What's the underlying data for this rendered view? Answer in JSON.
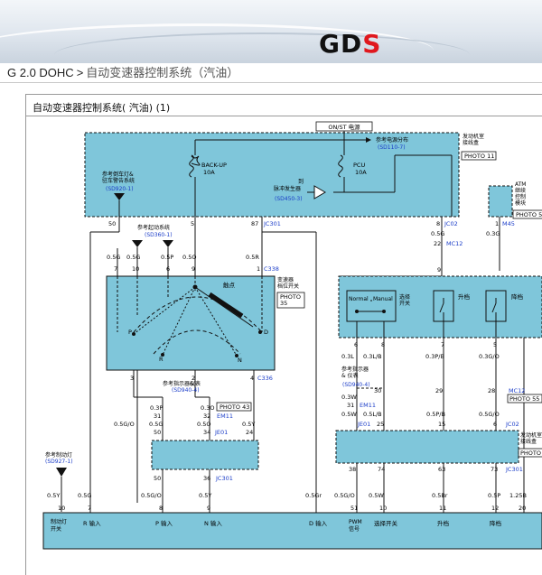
{
  "header": {
    "logo_text": "GD",
    "logo_mark": "S",
    "brand_color": "#e0181e"
  },
  "breadcrumb": {
    "root": "G 2.0 DOHC",
    "separator": ">",
    "current": "自动变速器控制系统（汽油）"
  },
  "panel": {
    "title": "自动变速器控制系统( 汽油) (1)"
  },
  "diagram": {
    "fill_color": "#7fc6da",
    "line_color": "#111111",
    "ref_color": "#1a3cc8",
    "top": {
      "power_label": "ON/ST 电源",
      "junction_box": "发动机室\n接线盒",
      "photo_junction": "PHOTO 11",
      "ref_power": "参考电源分布",
      "ref_power_code": "(SD110-7)",
      "fuse1_name": "BACK-UP",
      "fuse1_rating": "10A",
      "fuse2_name": "PCU",
      "fuse2_rating": "10A",
      "ref_brake": "参考倒车灯&\n驻车警告系统",
      "ref_brake_code": "(SD920-1)",
      "ref_pulse": "到\n脉冲发生器",
      "ref_pulse_code": "(SD450-3)",
      "atm_label": "ATM\n继续\n控制\n模块",
      "photo_atm": "PHOTO 5",
      "pin_50": "50",
      "pin_5": "5",
      "pin_87": "87",
      "conn_jc301_top": "JC301",
      "pin_8": "8",
      "conn_jc02_top": "JC02",
      "pin_1": "1",
      "conn_m45": "M45"
    },
    "inhibitor": {
      "ref_start": "参考起动系统",
      "ref_start_code": "(SD360-1)",
      "wires": [
        "0.5G",
        "0.5G",
        "0.5P",
        "0.5O",
        "0.5R"
      ],
      "pins_top": [
        "7",
        "10",
        "6",
        "9",
        "1"
      ],
      "conn": "C338",
      "switch_label": "变速器\n档位开关",
      "photo": "PHOTO\n35",
      "lever_label": "触点",
      "positions": [
        "P",
        "R",
        "N",
        "D"
      ],
      "pins_bottom": [
        "3",
        "2",
        "4"
      ],
      "conn_bottom": "C336"
    },
    "cluster": {
      "ref_meter": "参考指示器&\n仪表",
      "ref_meter_code": "(SD940-4)",
      "wire_left": "0.3P",
      "wire_right": "0.3O",
      "pins_top": [
        "31",
        "32"
      ],
      "conn": "EM11",
      "photo": "PHOTO 43",
      "wire_mid_left": "0.5G",
      "wire_mid_mid": "0.5O",
      "wire_mid_right": "0.5Y",
      "wire_far_left": "0.5G/O",
      "pins_mid": [
        "50",
        "34",
        "24"
      ],
      "conn_mid": "JE01",
      "pins_low": [
        "50",
        "36"
      ],
      "conn_low": "JC301"
    },
    "selector": {
      "pins": [
        "0.3V",
        "0.3B"
      ],
      "wire_pins": [
        "0.3L",
        "0.3L/B",
        "0.3P/B",
        "0.3G/O"
      ],
      "mode_normal": "Normal",
      "mode_manual": "Manual",
      "select_label": "选择\n开关",
      "upshift": "升档",
      "downshift": "降档",
      "pins_top": [
        "6",
        "8",
        "7",
        "5"
      ],
      "ref_meter": "参考指示器\n& 仪表",
      "ref_meter_code": "(SD940-4)",
      "conn_em11": "EM11",
      "conn_mc12": "MC12",
      "photo_55": "PHOTO 55",
      "wires_mid": [
        "0.3W",
        "0.5W",
        "0.5L/B",
        "0.5P/B",
        "0.5G/O"
      ],
      "pins_mid": [
        "30",
        "29",
        "28",
        "31",
        "25",
        "15",
        "6"
      ],
      "conn_je01": "JE01",
      "conn_jc02": "JC02",
      "photo_junction": "PHOTO",
      "junction_box": "发动机室\n接线盒",
      "mc12_pin": "22",
      "mc12_wire": "0.5G",
      "mc12_conn": "MC12",
      "m45_wire": "0.3G",
      "right_pin": "9"
    },
    "bottom": {
      "ref_brake": "参考制动灯",
      "ref_brake_code": "(SD927-1)",
      "wires": [
        "0.5Y",
        "0.5G",
        "0.5G/O",
        "0.5Y",
        "0.5Gr",
        "0.5G/O",
        "0.5W",
        "0.5Br",
        "0.5P",
        "1.25B"
      ],
      "pins_top": [
        "38",
        "74",
        "63",
        "73"
      ],
      "conn_jc301": "JC301",
      "pins": [
        "10",
        "7",
        "8",
        "9",
        "51",
        "10",
        "11",
        "12",
        "20"
      ],
      "labels": [
        "制动灯\n开关",
        "R 输入",
        "P 输入",
        "N 输入",
        "D 输入",
        "PWM\n信号",
        "选择开关",
        "升档",
        "降档"
      ]
    }
  }
}
